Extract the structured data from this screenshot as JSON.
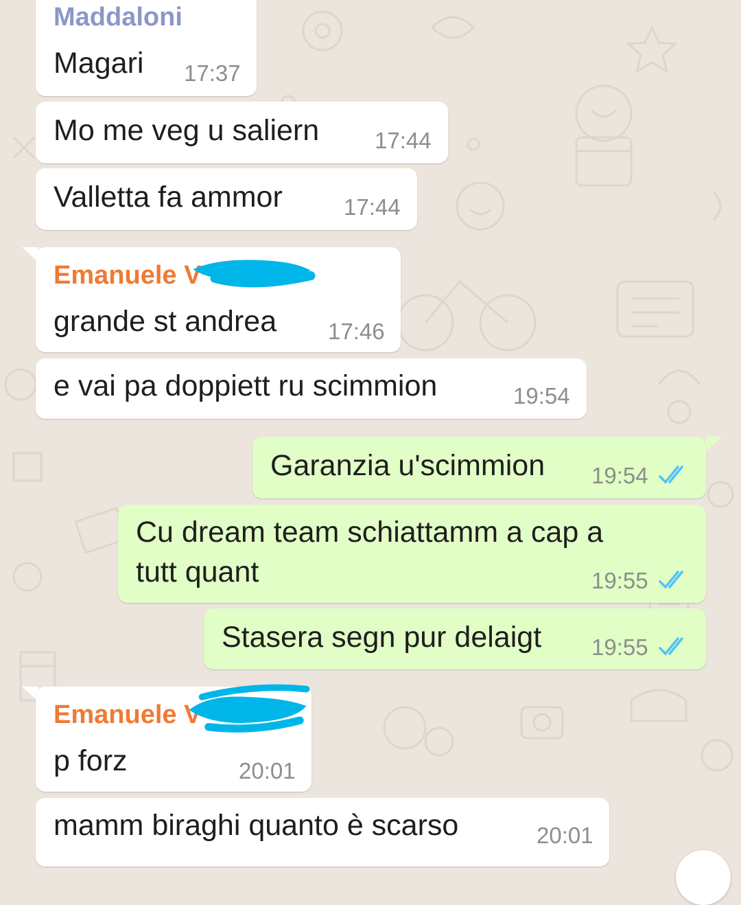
{
  "colors": {
    "chat_background": "#ECE5DD",
    "incoming_bubble": "#FFFFFF",
    "outgoing_bubble": "#E1FEC6",
    "sender_maddaloni": "#8C97C8",
    "sender_emanuele": "#F07A35",
    "read_ticks": "#4FC3F7",
    "redaction": "#00B6E8"
  },
  "messages": [
    {
      "direction": "incoming",
      "sender": "Maddaloni",
      "text": "Magari",
      "time": "17:37"
    },
    {
      "direction": "incoming",
      "text": "Mo me veg u saliern",
      "time": "17:44"
    },
    {
      "direction": "incoming",
      "text": "Valletta fa ammor",
      "time": "17:44"
    },
    {
      "direction": "incoming",
      "sender": "Emanuele V",
      "text": "grande st andrea",
      "time": "17:46"
    },
    {
      "direction": "incoming",
      "text": "e vai pa doppiett ru scimmion",
      "time": "19:54"
    },
    {
      "direction": "outgoing",
      "text": "Garanzia u'scimmion",
      "time": "19:54",
      "status": "read-double-check-icon"
    },
    {
      "direction": "outgoing",
      "text_line1": "Cu dream team schiattamm a cap a",
      "text_line2": "tutt quant",
      "time": "19:55",
      "status": "read-double-check-icon"
    },
    {
      "direction": "outgoing",
      "text": "Stasera segn pur delaigt",
      "time": "19:55",
      "status": "read-double-check-icon"
    },
    {
      "direction": "incoming",
      "sender": "Emanuele V",
      "text": "p forz",
      "time": "20:01"
    },
    {
      "direction": "incoming",
      "text": "mamm biraghi quanto è scarso",
      "time": "20:01"
    }
  ]
}
